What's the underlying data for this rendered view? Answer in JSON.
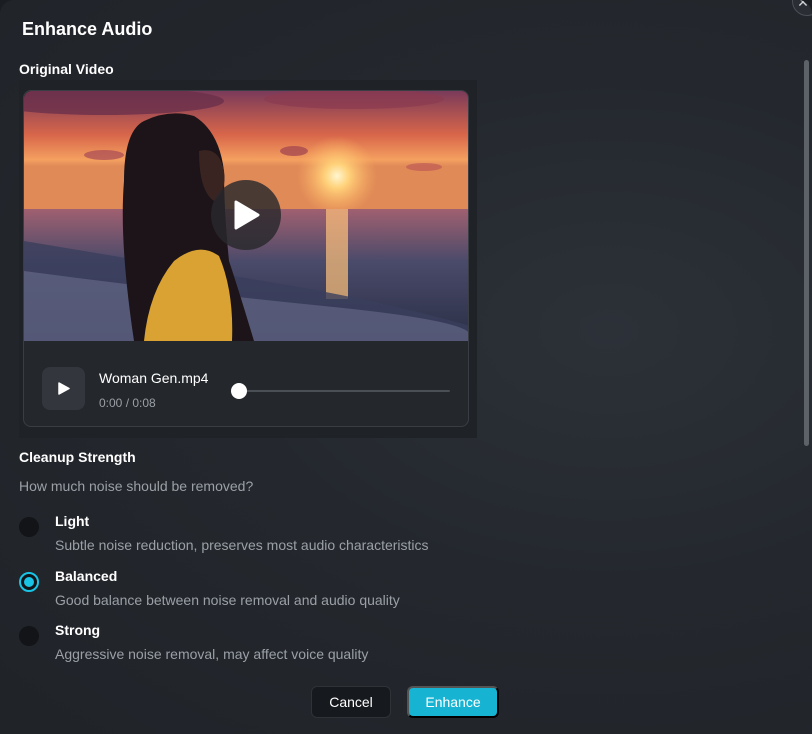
{
  "dialog": {
    "title": "Enhance Audio",
    "close_icon": "close-icon"
  },
  "original_video": {
    "label": "Original Video",
    "file_name": "Woman Gen.mp4",
    "time": "0:00 / 0:08",
    "progress": 0
  },
  "cleanup": {
    "label": "Cleanup Strength",
    "question": "How much noise should be removed?",
    "options": [
      {
        "title": "Light",
        "description": "Subtle noise reduction, preserves most audio characteristics",
        "selected": false
      },
      {
        "title": "Balanced",
        "description": "Good balance between noise removal and audio quality",
        "selected": true
      },
      {
        "title": "Strong",
        "description": "Aggressive noise removal, may affect voice quality",
        "selected": false
      }
    ]
  },
  "actions": {
    "cancel_label": "Cancel",
    "enhance_label": "Enhance"
  },
  "colors": {
    "accent": "#19c3e6",
    "primary_button": "#16b4d2",
    "background": "#24282e"
  }
}
